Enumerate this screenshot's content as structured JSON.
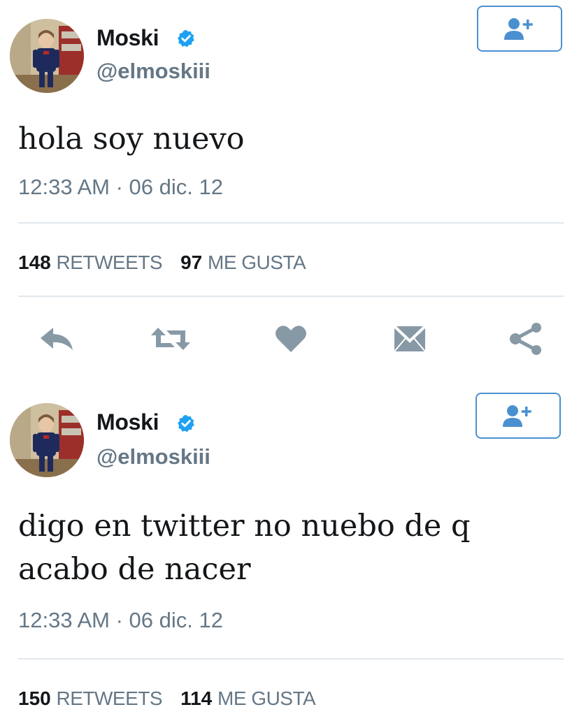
{
  "tweets": [
    {
      "display_name": "Moski",
      "handle": "@elmoskiii",
      "text": "hola soy nuevo",
      "timestamp": "12:33 AM · 06 dic. 12",
      "retweets_count": "148",
      "retweets_label": "RETWEETS",
      "likes_count": "97",
      "likes_label": "ME GUSTA"
    },
    {
      "display_name": "Moski",
      "handle": "@elmoskiii",
      "text": "digo en twitter no nuebo de q acabo de nacer",
      "timestamp": "12:33 AM · 06 dic. 12",
      "retweets_count": "150",
      "retweets_label": "RETWEETS",
      "likes_count": "114",
      "likes_label": "ME GUSTA"
    }
  ],
  "icons": {
    "verified": "verified-badge-icon",
    "follow": "add-user-icon",
    "reply": "reply-icon",
    "retweet": "retweet-icon",
    "like": "heart-icon",
    "message": "envelope-icon",
    "share": "share-icon"
  },
  "colors": {
    "text_primary": "#14171a",
    "text_secondary": "#657786",
    "verified_blue": "#1da1f2",
    "follow_blue": "#4a90d0",
    "icon_gray": "#8899a6",
    "divider": "#e1e8ed"
  }
}
